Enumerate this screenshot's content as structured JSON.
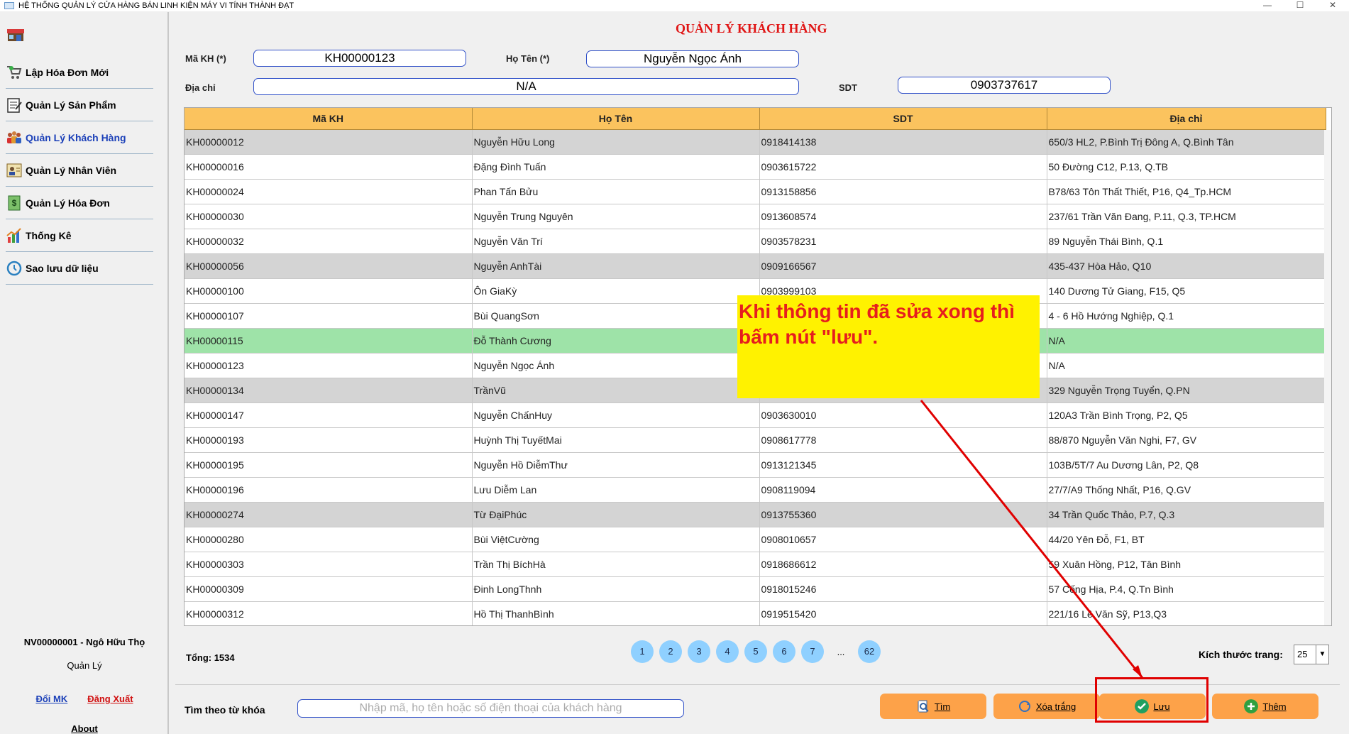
{
  "window": {
    "title": "HỆ THỐNG QUẢN LÝ CỬA HÀNG BÁN LINH KIỆN MÁY VI TÍNH THÀNH ĐẠT",
    "minimize": "—",
    "maximize": "☐",
    "close": "✕"
  },
  "sidebar": {
    "items": [
      {
        "label": "Lập Hóa Đơn Mới",
        "icon": "cart-icon"
      },
      {
        "label": "Quản Lý Sản Phẩm",
        "icon": "notepad-icon"
      },
      {
        "label": "Quản Lý Khách Hàng",
        "icon": "customers-icon",
        "active": true
      },
      {
        "label": "Quản Lý Nhân Viên",
        "icon": "employee-icon"
      },
      {
        "label": "Quản Lý Hóa Đơn",
        "icon": "invoice-icon"
      },
      {
        "label": "Thống Kê",
        "icon": "chart-icon"
      },
      {
        "label": "Sao lưu dữ liệu",
        "icon": "backup-icon"
      }
    ],
    "user": "NV00000001 - Ngô Hữu  Thọ",
    "role": "Quản Lý",
    "change_password": "Đổi MK",
    "logout": "Đăng Xuất",
    "about": "About"
  },
  "page_title": "QUẢN LÝ KHÁCH HÀNG",
  "form": {
    "ma_kh_label": "Mã KH (*)",
    "ma_kh_value": "KH00000123",
    "ho_ten_label": "Họ Tên (*)",
    "ho_ten_value": "Nguyễn Ngọc Ánh",
    "dia_chi_label": "Địa chỉ",
    "dia_chi_value": "N/A",
    "sdt_label": "SDT",
    "sdt_value": "0903737617"
  },
  "table": {
    "headers": [
      "Mã KH",
      "Họ Tên",
      "SDT",
      "Địa chỉ"
    ],
    "rows": [
      {
        "cells": [
          "KH00000012",
          "Nguyễn Hữu Long",
          "0918414138",
          "650/3 HL2, P.Bình Trị Đông A, Q.Bình Tân"
        ],
        "style": "gray"
      },
      {
        "cells": [
          "KH00000016",
          "Đặng Đình Tuấn",
          "0903615722",
          "50 Đường C12, P.13, Q.TB"
        ],
        "style": ""
      },
      {
        "cells": [
          "KH00000024",
          "Phan Tấn Bửu",
          "0913158856",
          "B78/63 Tôn Thất Thiết, P16, Q4_Tp.HCM"
        ],
        "style": ""
      },
      {
        "cells": [
          "KH00000030",
          "Nguyễn Trung Nguyên",
          "0913608574",
          "237/61 Trần Văn Đang, P.11, Q.3, TP.HCM"
        ],
        "style": ""
      },
      {
        "cells": [
          "KH00000032",
          "Nguyễn Văn Trí",
          "0903578231",
          "89 Nguyễn Thái Bình, Q.1"
        ],
        "style": ""
      },
      {
        "cells": [
          "KH00000056",
          "Nguyễn AnhTài",
          "0909166567",
          "435-437 Hòa Hảo, Q10"
        ],
        "style": "gray"
      },
      {
        "cells": [
          "KH00000100",
          "Ôn GiaKỳ",
          "0903999103",
          "140 Dương Tử Giang, F15, Q5"
        ],
        "style": ""
      },
      {
        "cells": [
          "KH00000107",
          "Bùi QuangSơn",
          "",
          "4 - 6 Hồ Hướng Nghiệp, Q.1"
        ],
        "style": ""
      },
      {
        "cells": [
          "KH00000115",
          "Đỗ Thành Cương",
          "",
          "N/A"
        ],
        "style": "green"
      },
      {
        "cells": [
          "KH00000123",
          "Nguyễn Ngọc Ánh",
          "",
          "N/A"
        ],
        "style": ""
      },
      {
        "cells": [
          "KH00000134",
          "TrầnVũ",
          "",
          "329 Nguyễn Trọng Tuyển, Q.PN"
        ],
        "style": "gray"
      },
      {
        "cells": [
          "KH00000147",
          "Nguyễn ChấnHuy",
          "0903630010",
          "120A3 Trần Bình Trọng, P2, Q5"
        ],
        "style": ""
      },
      {
        "cells": [
          "KH00000193",
          "Huỳnh Thị TuyếtMai",
          "0908617778",
          "88/870 Nguyễn Văn Nghi, F7, GV"
        ],
        "style": ""
      },
      {
        "cells": [
          "KH00000195",
          "Nguyễn Hồ DiễmThư",
          "0913121345",
          "103B/5T/7 Au Dương Lân, P2, Q8"
        ],
        "style": ""
      },
      {
        "cells": [
          "KH00000196",
          "Lưu Diễm Lan",
          "0908119094",
          "27/7/A9 Thống Nhất, P16, Q.GV"
        ],
        "style": ""
      },
      {
        "cells": [
          "KH00000274",
          "Từ ĐạiPhúc",
          "0913755360",
          "34 Trần Quốc Thảo, P.7, Q.3"
        ],
        "style": "gray"
      },
      {
        "cells": [
          "KH00000280",
          "Bùi ViệtCường",
          "0908010657",
          "44/20 Yên Đỗ, F1, BT"
        ],
        "style": ""
      },
      {
        "cells": [
          "KH00000303",
          "Trần Thị BíchHà",
          "0918686612",
          "59 Xuân Hồng, P12, Tân Bình"
        ],
        "style": ""
      },
      {
        "cells": [
          "KH00000309",
          "Đinh LongThnh",
          "0918015246",
          "57 Cống Hịa, P.4, Q.Tn Bình"
        ],
        "style": ""
      },
      {
        "cells": [
          "KH00000312",
          "Hồ Thị ThanhBình",
          "0919515420",
          "221/16 Lê Văn Sỹ, P13,Q3"
        ],
        "style": ""
      }
    ]
  },
  "pagination": {
    "total": "Tổng: 1534",
    "pages": [
      "1",
      "2",
      "3",
      "4",
      "5",
      "6",
      "7"
    ],
    "ellipsis": "...",
    "last": "62",
    "page_size_label": "Kích thước trang:",
    "page_size": "25",
    "page_size_arrow": "▼"
  },
  "search": {
    "label": "Tìm theo từ khóa",
    "placeholder": "Nhập mã, họ tên hoặc số điện thoại của khách hàng"
  },
  "buttons": {
    "tim": "Tìm",
    "xoa_trang": "Xóa trắng",
    "luu": "Lưu",
    "them": "Thêm"
  },
  "annotation": {
    "text": "Khi thông tin đã sửa xong thì bấm nút \"lưu\"."
  },
  "colors": {
    "header": "#fbc35e",
    "accent_button": "#fda249",
    "selected_row": "#9ee3a8",
    "callout": "#fff200",
    "arrow": "#e00000"
  }
}
